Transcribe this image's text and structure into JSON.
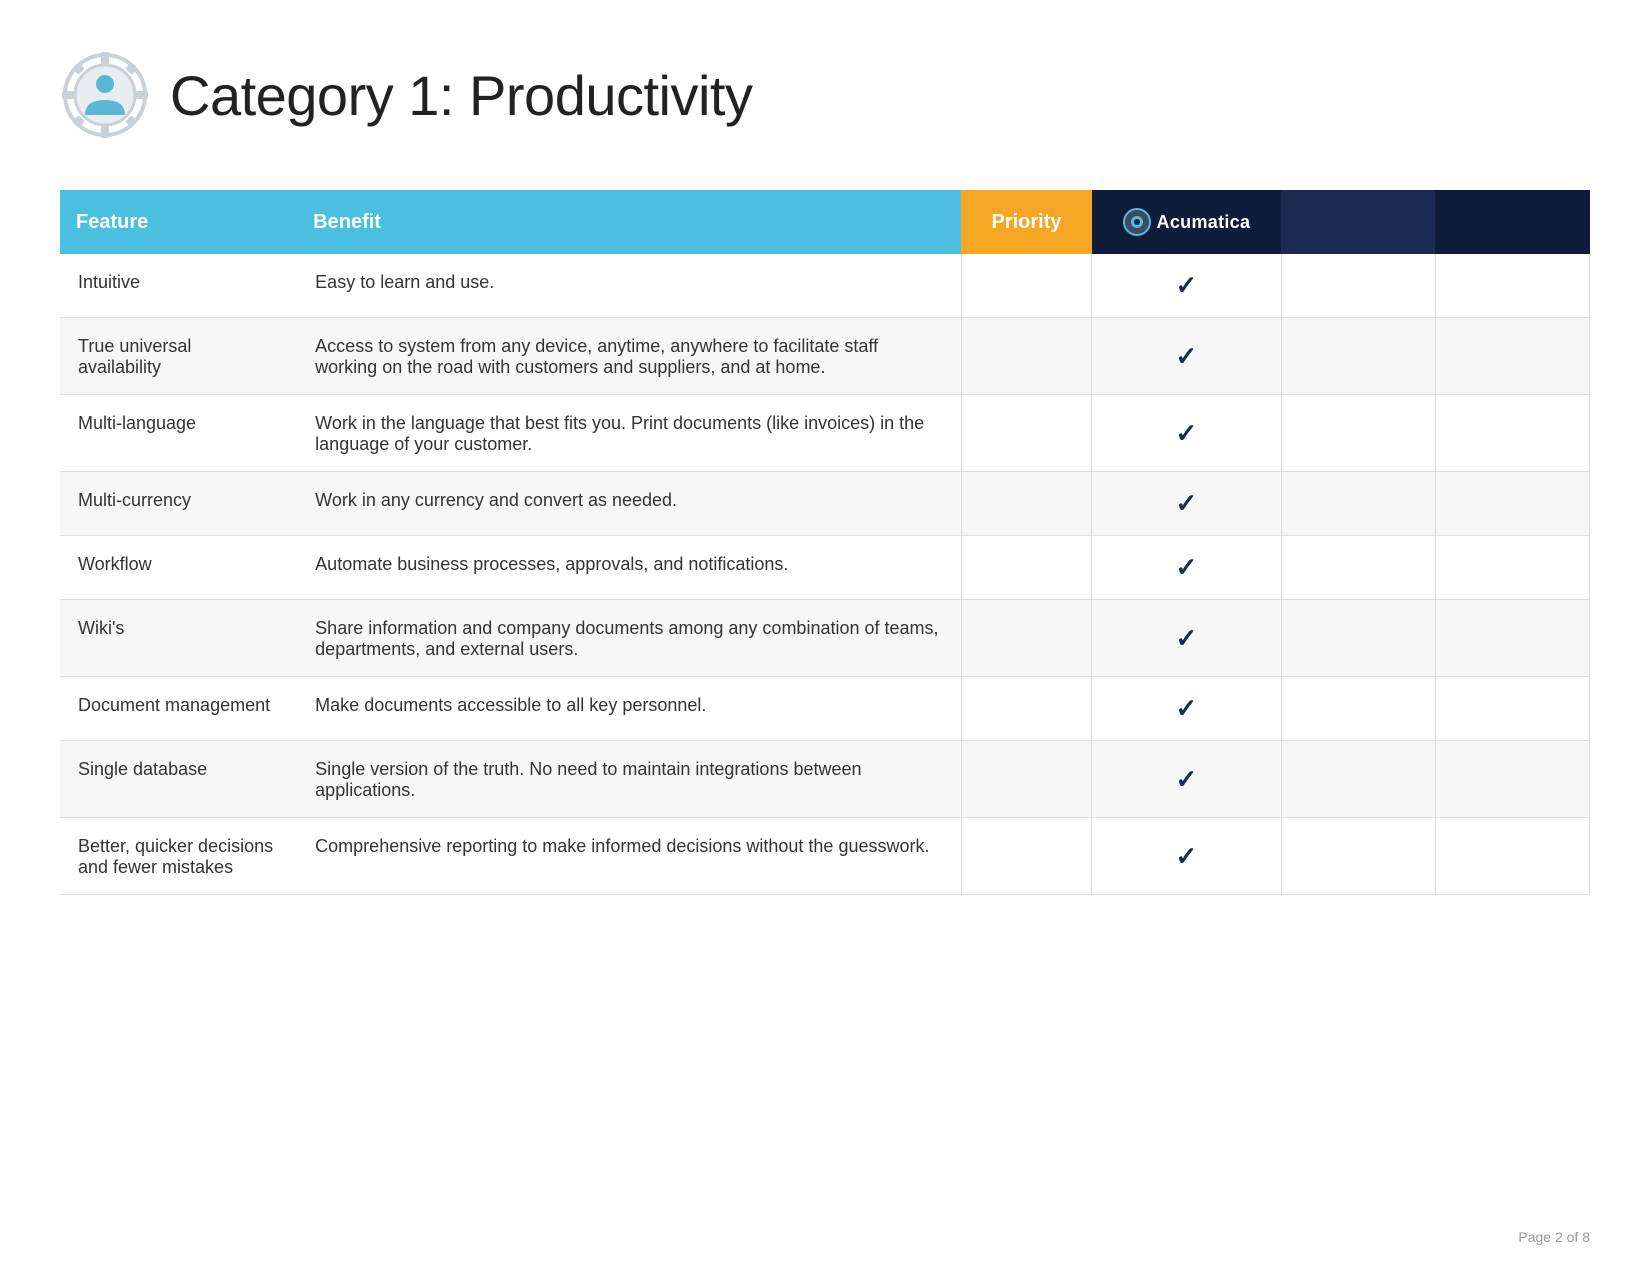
{
  "header": {
    "title": "Category 1: Productivity",
    "icon_alt": "productivity-category-icon"
  },
  "table": {
    "columns": {
      "feature": "Feature",
      "benefit": "Benefit",
      "priority": "Priority",
      "acumatica": "Acumatica",
      "comp1": "",
      "comp2": ""
    },
    "rows": [
      {
        "feature": "Intuitive",
        "benefit": "Easy to learn and use.",
        "priority": false,
        "acumatica": true,
        "comp1": false,
        "comp2": false
      },
      {
        "feature": "True universal availability",
        "benefit": "Access to system from any device, anytime, anywhere to facilitate staff working on the road with customers and suppliers, and at home.",
        "priority": false,
        "acumatica": true,
        "comp1": false,
        "comp2": false
      },
      {
        "feature": "Multi-language",
        "benefit": "Work in the language that best fits you. Print documents (like invoices) in the language of your customer.",
        "priority": false,
        "acumatica": true,
        "comp1": false,
        "comp2": false
      },
      {
        "feature": "Multi-currency",
        "benefit": "Work in any currency and convert as needed.",
        "priority": false,
        "acumatica": true,
        "comp1": false,
        "comp2": false
      },
      {
        "feature": "Workflow",
        "benefit": "Automate business processes, approvals, and notifications.",
        "priority": false,
        "acumatica": true,
        "comp1": false,
        "comp2": false
      },
      {
        "feature": "Wiki's",
        "benefit": "Share information and company documents among any combination of teams, departments, and external users.",
        "priority": false,
        "acumatica": true,
        "comp1": false,
        "comp2": false
      },
      {
        "feature": "Document management",
        "benefit": "Make documents accessible to all key personnel.",
        "priority": false,
        "acumatica": true,
        "comp1": false,
        "comp2": false
      },
      {
        "feature": "Single database",
        "benefit": "Single version of the truth. No need to maintain integrations between applications.",
        "priority": false,
        "acumatica": true,
        "comp1": false,
        "comp2": false
      },
      {
        "feature": "Better, quicker decisions and fewer mistakes",
        "benefit": "Comprehensive reporting to make informed decisions without the guesswork.",
        "priority": false,
        "acumatica": true,
        "comp1": false,
        "comp2": false
      }
    ]
  },
  "footer": {
    "text": "Page 2 of 8"
  }
}
